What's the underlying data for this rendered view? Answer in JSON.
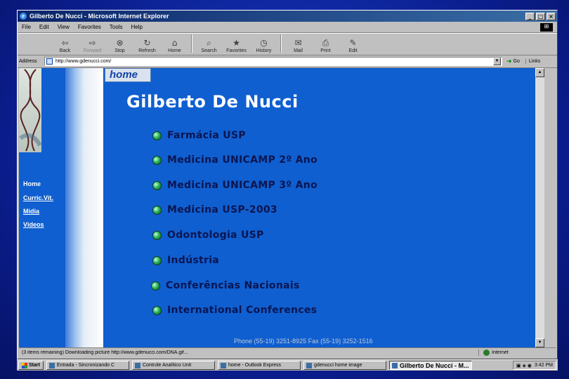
{
  "window": {
    "title": "Gilberto De Nucci - Microsoft Internet Explorer",
    "minimize": "_",
    "maximize": "□",
    "close": "×"
  },
  "menu": [
    "File",
    "Edit",
    "View",
    "Favorites",
    "Tools",
    "Help"
  ],
  "toolbar": [
    {
      "label": "Back",
      "icon": "back-arrow-icon",
      "glyph": "⇦"
    },
    {
      "label": "Forward",
      "icon": "forward-arrow-icon",
      "glyph": "⇨"
    },
    {
      "label": "Stop",
      "icon": "stop-icon",
      "glyph": "⊗"
    },
    {
      "label": "Refresh",
      "icon": "refresh-icon",
      "glyph": "↻"
    },
    {
      "label": "Home",
      "icon": "home-icon",
      "glyph": "⌂"
    },
    {
      "label": "Search",
      "icon": "search-icon",
      "glyph": "⌕"
    },
    {
      "label": "Favorites",
      "icon": "favorites-icon",
      "glyph": "★"
    },
    {
      "label": "History",
      "icon": "history-icon",
      "glyph": "◷"
    },
    {
      "label": "Mail",
      "icon": "mail-icon",
      "glyph": "✉"
    },
    {
      "label": "Print",
      "icon": "print-icon",
      "glyph": "⎙"
    },
    {
      "label": "Edit",
      "icon": "edit-icon",
      "glyph": "✎"
    }
  ],
  "address": {
    "label": "Address",
    "url": "http://www.gdenucci.com/",
    "go": "Go",
    "links": "Links"
  },
  "page": {
    "home_tab": "home",
    "title": "Gilberto De Nucci",
    "nav": [
      {
        "label": "Home"
      },
      {
        "label": "Curric.Vit."
      },
      {
        "label": "Mídia"
      },
      {
        "label": "Vídeos"
      }
    ],
    "items": [
      "Farmácia USP",
      "Medicina UNICAMP 2º Ano",
      "Medicina UNICAMP 3º Ano",
      "Medicina USP-2003",
      "Odontologia USP",
      "Indústria",
      "Conferências Nacionais",
      "International Conferences"
    ],
    "phone": "Phone (55-19) 3251-8925  Fax (55-19) 3252-1516"
  },
  "status": {
    "text": "(3 items remaining) Downloading picture http://www.gdenucci.com/DNA.gif...",
    "zone": "Internet"
  },
  "taskbar": {
    "start": "Start",
    "tasks": [
      "Entrada - Sincronizando C",
      "Controle Analítico Unit",
      "home - Outlook Express",
      "gdenucci home image",
      "Gilberto De Nucci - M..."
    ],
    "clock": "3:42 PM"
  },
  "colors": {
    "page_bg": "#0f5fd0",
    "menu_text": "#0b1550",
    "bullet": "#2bb35a"
  }
}
